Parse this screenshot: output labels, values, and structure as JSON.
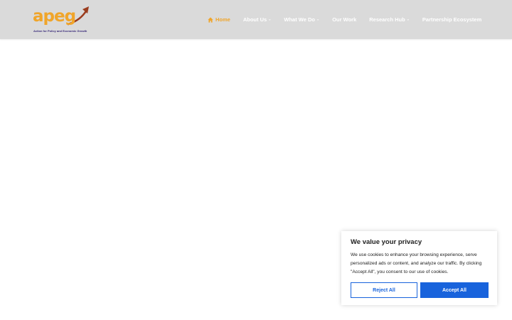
{
  "logo": {
    "name": "apeg",
    "tagline": "Action for Policy and Economic Growth"
  },
  "nav": {
    "items": [
      {
        "label": "Home",
        "active": true,
        "icon": "home-icon"
      },
      {
        "label": "About Us",
        "dropdown": true
      },
      {
        "label": "What We Do",
        "dropdown": true
      },
      {
        "label": "Our Work",
        "dropdown": false
      },
      {
        "label": "Research Hub",
        "dropdown": true
      },
      {
        "label": "Partnership Ecosystem",
        "dropdown": false
      }
    ],
    "chevron": "⌄"
  },
  "cookie": {
    "title": "We value your privacy",
    "text": "We use cookies to enhance your browsing experience, serve personalized ads or content, and analyze our traffic. By clicking \"Accept All\", you consent to our use of cookies.",
    "reject_label": "Reject All",
    "accept_label": "Accept All"
  },
  "colors": {
    "header_bg": "#dadada",
    "accent_orange": "#f0a52a",
    "button_blue": "#1863dc",
    "nav_text": "#ffffff"
  }
}
